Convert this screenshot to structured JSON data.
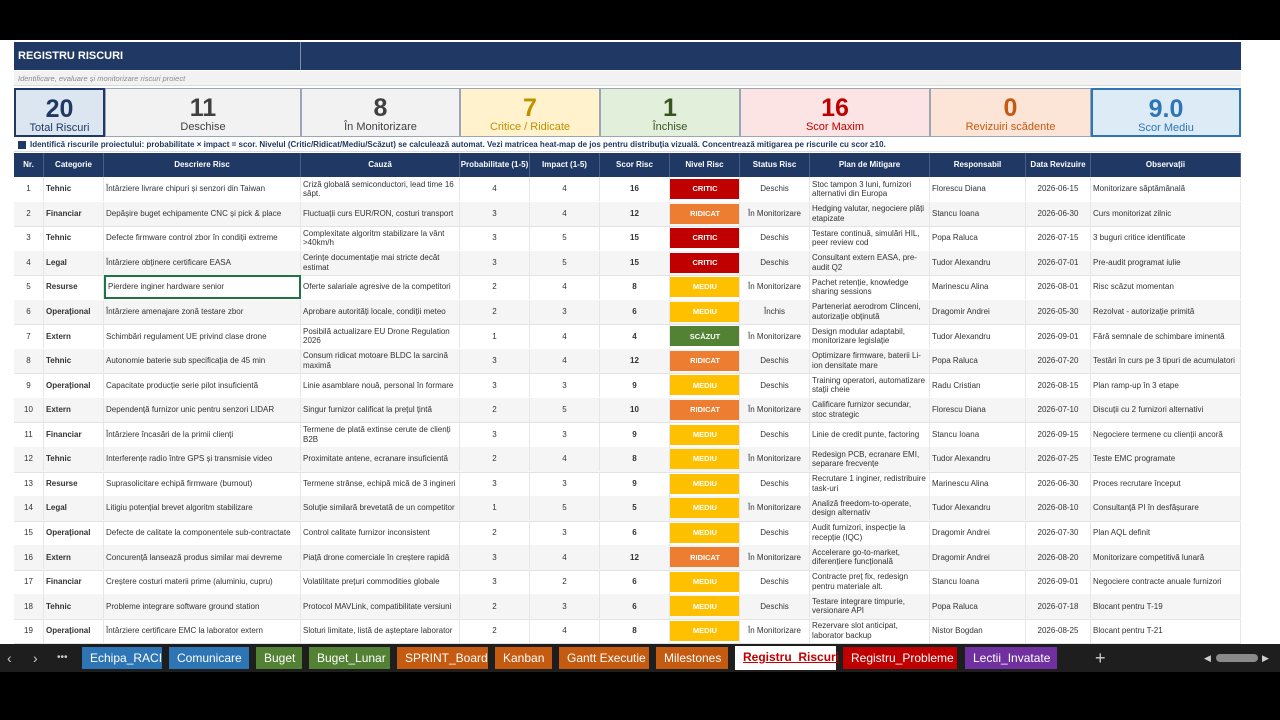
{
  "title": "REGISTRU RISCURI",
  "subtitle": "Identificare, evaluare și monitorizare riscuri proiect",
  "kpis": [
    {
      "value": "20",
      "label": "Total Riscuri",
      "bg": "#dce6f1",
      "color": "#1f3864"
    },
    {
      "value": "11",
      "label": "Deschise",
      "bg": "#f2f2f2",
      "color": "#404040"
    },
    {
      "value": "8",
      "label": "În Monitorizare",
      "bg": "#f2f2f2",
      "color": "#404040"
    },
    {
      "value": "7",
      "label": "Critice / Ridicate",
      "bg": "#fff2cc",
      "color": "#bf8f00"
    },
    {
      "value": "1",
      "label": "Închise",
      "bg": "#e2efda",
      "color": "#375623"
    },
    {
      "value": "16",
      "label": "Scor Maxim",
      "bg": "#fce4e4",
      "color": "#c00000"
    },
    {
      "value": "0",
      "label": "Revizuiri scădente",
      "bg": "#fce4d6",
      "color": "#c65911"
    },
    {
      "value": "9.0",
      "label": "Scor Mediu",
      "bg": "#ddebf7",
      "color": "#2e75b6"
    }
  ],
  "info": "Identifică riscurile proiectului: probabilitate × impact = scor. Nivelul (Critic/Ridicat/Mediu/Scăzut) se calculează automat. Vezi matricea heat-map de jos pentru distribuția vizuală. Concentrează mitigarea pe riscurile cu scor ≥10.",
  "headers": [
    "Nr.",
    "Categorie",
    "Descriere Risc",
    "Cauză",
    "Probabilitate (1-5)",
    "Impact (1-5)",
    "Scor Risc",
    "Nivel Risc",
    "Status Risc",
    "Plan de Mitigare",
    "Responsabil",
    "Data Revizuire",
    "Observații"
  ],
  "level_colors": {
    "CRITIC": "#c00000",
    "RIDICAT": "#ed7d31",
    "MEDIU": "#ffc000",
    "SCĂZUT": "#548235"
  },
  "rows": [
    {
      "nr": "1",
      "cat": "Tehnic",
      "desc": "Întârziere livrare chipuri și senzori din Taiwan",
      "cauza": "Criză globală semiconductori, lead time 16 săpt.",
      "prob": "4",
      "imp": "4",
      "scor": "16",
      "nivel": "CRITIC",
      "status": "Deschis",
      "plan": "Stoc tampon 3 luni, furnizori alternativi din Europa",
      "resp": "Florescu Diana",
      "data": "2026-06-15",
      "obs": "Monitorizare săptămânală"
    },
    {
      "nr": "2",
      "cat": "Financiar",
      "desc": "Depășire buget echipamente CNC și pick & place",
      "cauza": "Fluctuații curs EUR/RON, costuri transport",
      "prob": "3",
      "imp": "4",
      "scor": "12",
      "nivel": "RIDICAT",
      "status": "În Monitorizare",
      "plan": "Hedging valutar, negociere plăți etapizate",
      "resp": "Stancu Ioana",
      "data": "2026-06-30",
      "obs": "Curs monitorizat zilnic"
    },
    {
      "nr": "3",
      "cat": "Tehnic",
      "desc": "Defecte firmware control zbor în condiții extreme",
      "cauza": "Complexitate algoritm stabilizare la vânt >40km/h",
      "prob": "3",
      "imp": "5",
      "scor": "15",
      "nivel": "CRITIC",
      "status": "Deschis",
      "plan": "Testare continuă, simulări HIL, peer review cod",
      "resp": "Popa Raluca",
      "data": "2026-07-15",
      "obs": "3 buguri critice identificate"
    },
    {
      "nr": "4",
      "cat": "Legal",
      "desc": "Întârziere obținere certificare EASA",
      "cauza": "Cerințe documentație mai stricte decât estimat",
      "prob": "3",
      "imp": "5",
      "scor": "15",
      "nivel": "CRITIC",
      "status": "Deschis",
      "plan": "Consultant extern EASA, pre-audit Q2",
      "resp": "Tudor Alexandru",
      "data": "2026-07-01",
      "obs": "Pre-audit programat iulie"
    },
    {
      "nr": "5",
      "cat": "Resurse",
      "desc": "Pierdere inginer hardware senior",
      "cauza": "Oferte salariale agresive de la competitori",
      "prob": "2",
      "imp": "4",
      "scor": "8",
      "nivel": "MEDIU",
      "status": "În Monitorizare",
      "plan": "Pachet retenție, knowledge sharing sessions",
      "resp": "Marinescu Alina",
      "data": "2026-08-01",
      "obs": "Risc scăzut momentan"
    },
    {
      "nr": "6",
      "cat": "Operațional",
      "desc": "Întârziere amenajare zonă testare zbor",
      "cauza": "Aprobare autorități locale, condiții meteo",
      "prob": "2",
      "imp": "3",
      "scor": "6",
      "nivel": "MEDIU",
      "status": "Închis",
      "plan": "Parteneriat aerodrom Clinceni, autorizație obținută",
      "resp": "Dragomir Andrei",
      "data": "2026-05-30",
      "obs": "Rezolvat - autorizație primită"
    },
    {
      "nr": "7",
      "cat": "Extern",
      "desc": "Schimbări regulament UE privind clase drone",
      "cauza": "Posibilă actualizare EU Drone Regulation 2026",
      "prob": "1",
      "imp": "4",
      "scor": "4",
      "nivel": "SCĂZUT",
      "status": "În Monitorizare",
      "plan": "Design modular adaptabil, monitorizare legislație",
      "resp": "Tudor Alexandru",
      "data": "2026-09-01",
      "obs": "Fără semnale de schimbare iminentă"
    },
    {
      "nr": "8",
      "cat": "Tehnic",
      "desc": "Autonomie baterie sub specificația de 45 min",
      "cauza": "Consum ridicat motoare BLDC la sarcină maximă",
      "prob": "3",
      "imp": "4",
      "scor": "12",
      "nivel": "RIDICAT",
      "status": "Deschis",
      "plan": "Optimizare firmware, baterii Li-ion densitate mare",
      "resp": "Popa Raluca",
      "data": "2026-07-20",
      "obs": "Testări în curs pe 3 tipuri de acumulatori"
    },
    {
      "nr": "9",
      "cat": "Operațional",
      "desc": "Capacitate producție serie pilot insuficientă",
      "cauza": "Linie asamblare nouă, personal în formare",
      "prob": "3",
      "imp": "3",
      "scor": "9",
      "nivel": "MEDIU",
      "status": "Deschis",
      "plan": "Training operatori, automatizare stații cheie",
      "resp": "Radu Cristian",
      "data": "2026-08-15",
      "obs": "Plan ramp-up în 3 etape"
    },
    {
      "nr": "10",
      "cat": "Extern",
      "desc": "Dependență furnizor unic pentru senzori LIDAR",
      "cauza": "Singur furnizor calificat la prețul țintă",
      "prob": "2",
      "imp": "5",
      "scor": "10",
      "nivel": "RIDICAT",
      "status": "În Monitorizare",
      "plan": "Calificare furnizor secundar, stoc strategic",
      "resp": "Florescu Diana",
      "data": "2026-07-10",
      "obs": "Discuții cu 2 furnizori alternativi"
    },
    {
      "nr": "11",
      "cat": "Financiar",
      "desc": "Întârziere încasări de la primii clienți",
      "cauza": "Termene de plată extinse cerute de clienți B2B",
      "prob": "3",
      "imp": "3",
      "scor": "9",
      "nivel": "MEDIU",
      "status": "Deschis",
      "plan": "Linie de credit punte, factoring",
      "resp": "Stancu Ioana",
      "data": "2026-09-15",
      "obs": "Negociere termene cu clienții ancoră"
    },
    {
      "nr": "12",
      "cat": "Tehnic",
      "desc": "Interferențe radio între GPS și transmisie video",
      "cauza": "Proximitate antene, ecranare insuficientă",
      "prob": "2",
      "imp": "4",
      "scor": "8",
      "nivel": "MEDIU",
      "status": "În Monitorizare",
      "plan": "Redesign PCB, ecranare EMI, separare frecvențe",
      "resp": "Tudor Alexandru",
      "data": "2026-07-25",
      "obs": "Teste EMC programate"
    },
    {
      "nr": "13",
      "cat": "Resurse",
      "desc": "Suprasolicitare echipă firmware (burnout)",
      "cauza": "Termene strânse, echipă mică de 3 ingineri",
      "prob": "3",
      "imp": "3",
      "scor": "9",
      "nivel": "MEDIU",
      "status": "Deschis",
      "plan": "Recrutare 1 inginer, redistribuire task-uri",
      "resp": "Marinescu Alina",
      "data": "2026-06-30",
      "obs": "Proces recrutare început"
    },
    {
      "nr": "14",
      "cat": "Legal",
      "desc": "Litigiu potențial brevet algoritm stabilizare",
      "cauza": "Soluție similară brevetată de un competitor",
      "prob": "1",
      "imp": "5",
      "scor": "5",
      "nivel": "MEDIU",
      "status": "În Monitorizare",
      "plan": "Analiză freedom-to-operate, design alternativ",
      "resp": "Tudor Alexandru",
      "data": "2026-08-10",
      "obs": "Consultanță PI în desfășurare"
    },
    {
      "nr": "15",
      "cat": "Operațional",
      "desc": "Defecte de calitate la componentele sub-contractate",
      "cauza": "Control calitate furnizor inconsistent",
      "prob": "2",
      "imp": "3",
      "scor": "6",
      "nivel": "MEDIU",
      "status": "Deschis",
      "plan": "Audit furnizori, inspecție la recepție (IQC)",
      "resp": "Dragomir Andrei",
      "data": "2026-07-30",
      "obs": "Plan AQL definit"
    },
    {
      "nr": "16",
      "cat": "Extern",
      "desc": "Concurență lansează produs similar mai devreme",
      "cauza": "Piață drone comerciale în creștere rapidă",
      "prob": "3",
      "imp": "4",
      "scor": "12",
      "nivel": "RIDICAT",
      "status": "În Monitorizare",
      "plan": "Accelerare go-to-market, diferențiere funcțională",
      "resp": "Dragomir Andrei",
      "data": "2026-08-20",
      "obs": "Monitorizare competitivă lunară"
    },
    {
      "nr": "17",
      "cat": "Financiar",
      "desc": "Creștere costuri materii prime (aluminiu, cupru)",
      "cauza": "Volatilitate prețuri commodities globale",
      "prob": "3",
      "imp": "2",
      "scor": "6",
      "nivel": "MEDIU",
      "status": "Deschis",
      "plan": "Contracte preț fix, redesign pentru materiale alt.",
      "resp": "Stancu Ioana",
      "data": "2026-09-01",
      "obs": "Negociere contracte anuale furnizori"
    },
    {
      "nr": "18",
      "cat": "Tehnic",
      "desc": "Probleme integrare software ground station",
      "cauza": "Protocol MAVLink, compatibilitate versiuni",
      "prob": "2",
      "imp": "3",
      "scor": "6",
      "nivel": "MEDIU",
      "status": "Deschis",
      "plan": "Testare integrare timpurie, versionare API",
      "resp": "Popa Raluca",
      "data": "2026-07-18",
      "obs": "Blocant pentru T-19"
    },
    {
      "nr": "19",
      "cat": "Operațional",
      "desc": "Întârziere certificare EMC la laborator extern",
      "cauza": "Sloturi limitate, listă de așteptare laborator",
      "prob": "2",
      "imp": "4",
      "scor": "8",
      "nivel": "MEDIU",
      "status": "În Monitorizare",
      "plan": "Rezervare slot anticipat, laborator backup",
      "resp": "Nistor Bogdan",
      "data": "2026-08-25",
      "obs": "Blocant pentru T-21"
    }
  ],
  "nav": {
    "prev": "‹",
    "next": "›",
    "more": "•••",
    "add": "+"
  },
  "tabs": [
    {
      "label": "Echipa_RACI",
      "bg": "#2e75b6",
      "fg": "#ffffff",
      "active": false
    },
    {
      "label": "Comunicare",
      "bg": "#2e75b6",
      "fg": "#ffffff",
      "active": false
    },
    {
      "label": "Buget",
      "bg": "#548235",
      "fg": "#ffffff",
      "active": false
    },
    {
      "label": "Buget_Lunar",
      "bg": "#548235",
      "fg": "#ffffff",
      "active": false
    },
    {
      "label": "SPRINT_Board",
      "bg": "#c55a11",
      "fg": "#ffffff",
      "active": false
    },
    {
      "label": "Kanban",
      "bg": "#c55a11",
      "fg": "#ffffff",
      "active": false
    },
    {
      "label": "Gantt Executie",
      "bg": "#c55a11",
      "fg": "#ffffff",
      "active": false
    },
    {
      "label": "Milestones",
      "bg": "#c55a11",
      "fg": "#ffffff",
      "active": false
    },
    {
      "label": "Registru_Riscuri",
      "bg": "#ffffff",
      "fg": "#c00000",
      "active": true
    },
    {
      "label": "Registru_Probleme",
      "bg": "#c00000",
      "fg": "#ffffff",
      "active": false
    },
    {
      "label": "Lectii_Invatate",
      "bg": "#7030a0",
      "fg": "#ffffff",
      "active": false
    }
  ]
}
